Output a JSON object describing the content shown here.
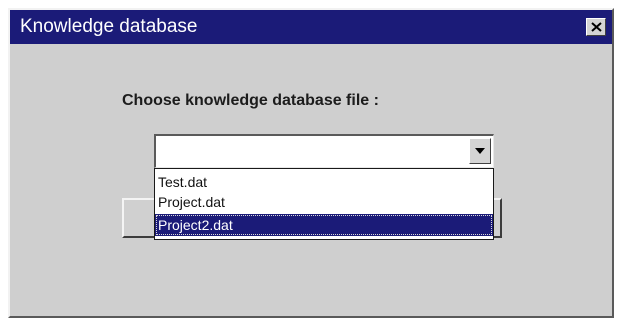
{
  "window": {
    "title": "Knowledge database",
    "close_icon": "close-icon"
  },
  "dialog": {
    "prompt": "Choose knowledge database file :"
  },
  "combo": {
    "value": "",
    "arrow_icon": "chevron-down-icon"
  },
  "dropdown": {
    "options": [
      "Test.dat",
      "Project.dat",
      "Project2.dat"
    ],
    "selected": "Project2.dat"
  },
  "buttons": {
    "left_label": "",
    "right_label": ""
  },
  "colors": {
    "titlebar": "#1b1b78",
    "selection": "#1b1b78",
    "face": "#cfcfcf"
  }
}
